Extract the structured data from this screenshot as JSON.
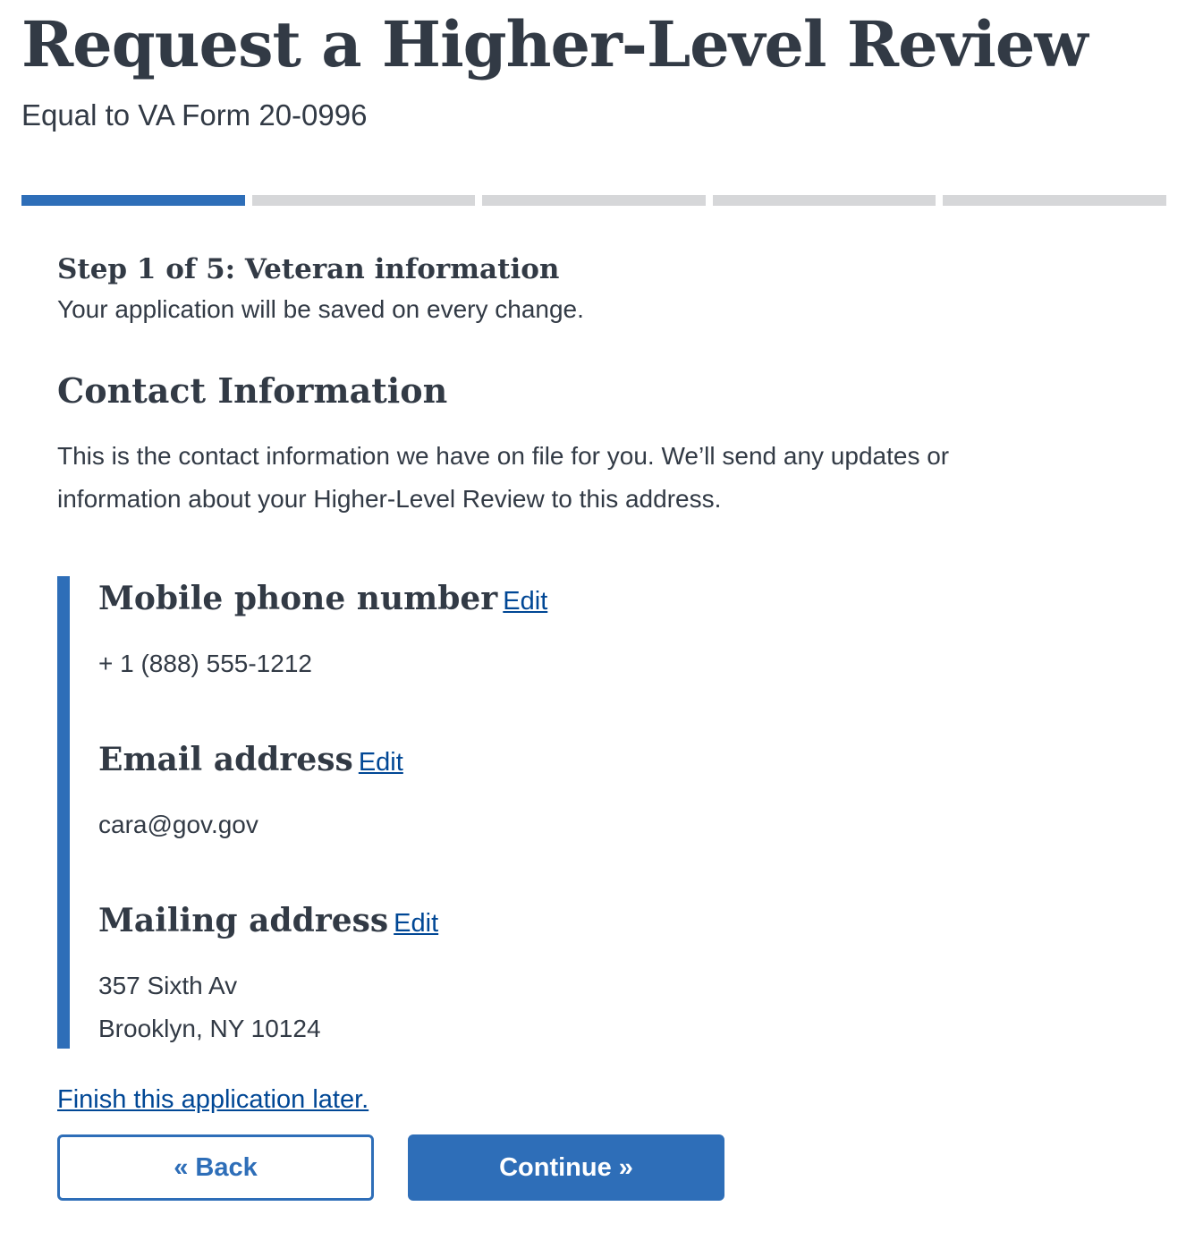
{
  "header": {
    "title": "Request a Higher-Level Review",
    "subtitle": "Equal to VA Form 20-0996"
  },
  "progress": {
    "total_steps": 5,
    "current_step": 1
  },
  "step": {
    "title": "Step 1 of 5: Veteran information",
    "note": "Your application will be saved on every change."
  },
  "contact": {
    "title": "Contact Information",
    "description": "This is the contact information we have on file for you. We’ll send any updates or information about your Higher-Level Review to this address.",
    "phone": {
      "heading": "Mobile phone number",
      "edit_label": "Edit",
      "value": "+ 1 (888) 555-1212"
    },
    "email": {
      "heading": "Email address",
      "edit_label": "Edit",
      "value": "cara@gov.gov"
    },
    "mailing": {
      "heading": "Mailing address",
      "edit_label": "Edit",
      "line1": "357 Sixth Av",
      "line2": "Brooklyn, NY 10124"
    }
  },
  "actions": {
    "finish_later": "Finish this application later.",
    "back_label": "« Back",
    "continue_label": "Continue »"
  },
  "colors": {
    "accent": "#2e6eb8",
    "link": "#004795",
    "text": "#323a45",
    "progress_inactive": "#d6d7d9"
  }
}
